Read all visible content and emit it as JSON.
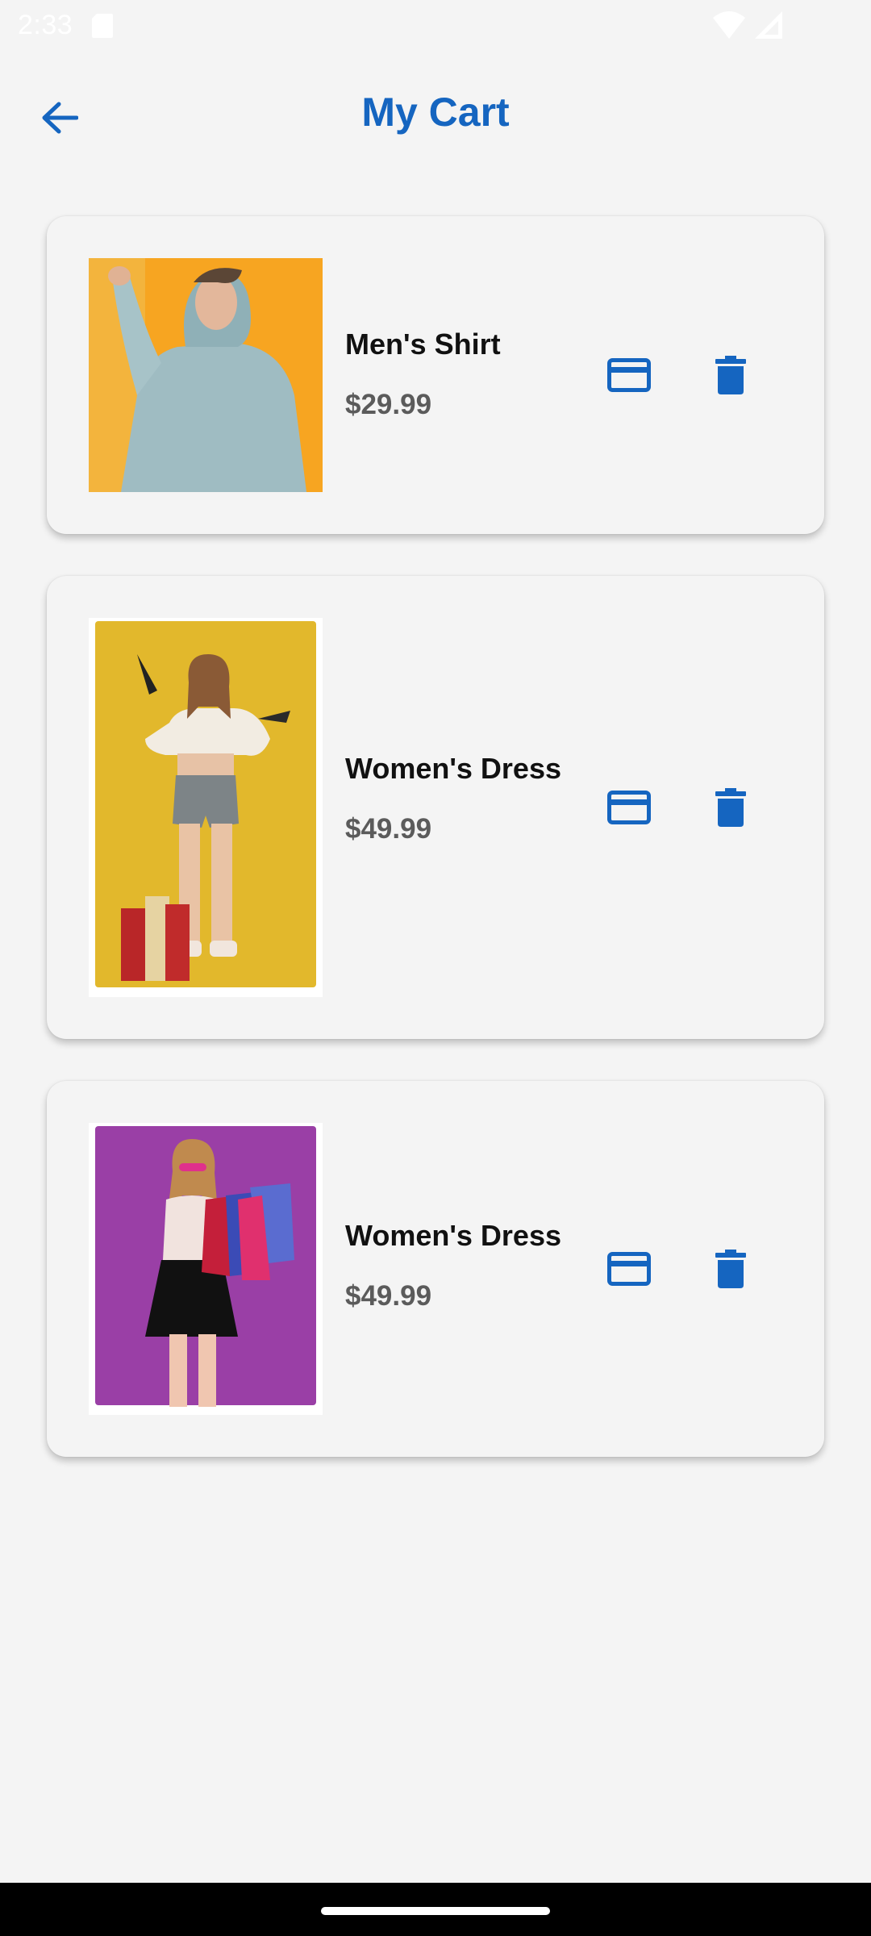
{
  "status_bar": {
    "time": "2:33"
  },
  "header": {
    "title": "My Cart"
  },
  "colors": {
    "accent": "#1565c0",
    "price": "#5b5b5b",
    "background": "#f4f4f4"
  },
  "cart": {
    "items": [
      {
        "name": "Men's Shirt",
        "price": "$29.99",
        "image": "man-in-hoodie-photo",
        "pay_icon": "credit-card-icon",
        "delete_icon": "trash-icon"
      },
      {
        "name": "Women's Dress",
        "price": "$49.99",
        "image": "woman-holding-heels-photo",
        "pay_icon": "credit-card-icon",
        "delete_icon": "trash-icon"
      },
      {
        "name": "Women's Dress",
        "price": "$49.99",
        "image": "woman-with-shopping-bags-photo",
        "pay_icon": "credit-card-icon",
        "delete_icon": "trash-icon"
      }
    ]
  }
}
